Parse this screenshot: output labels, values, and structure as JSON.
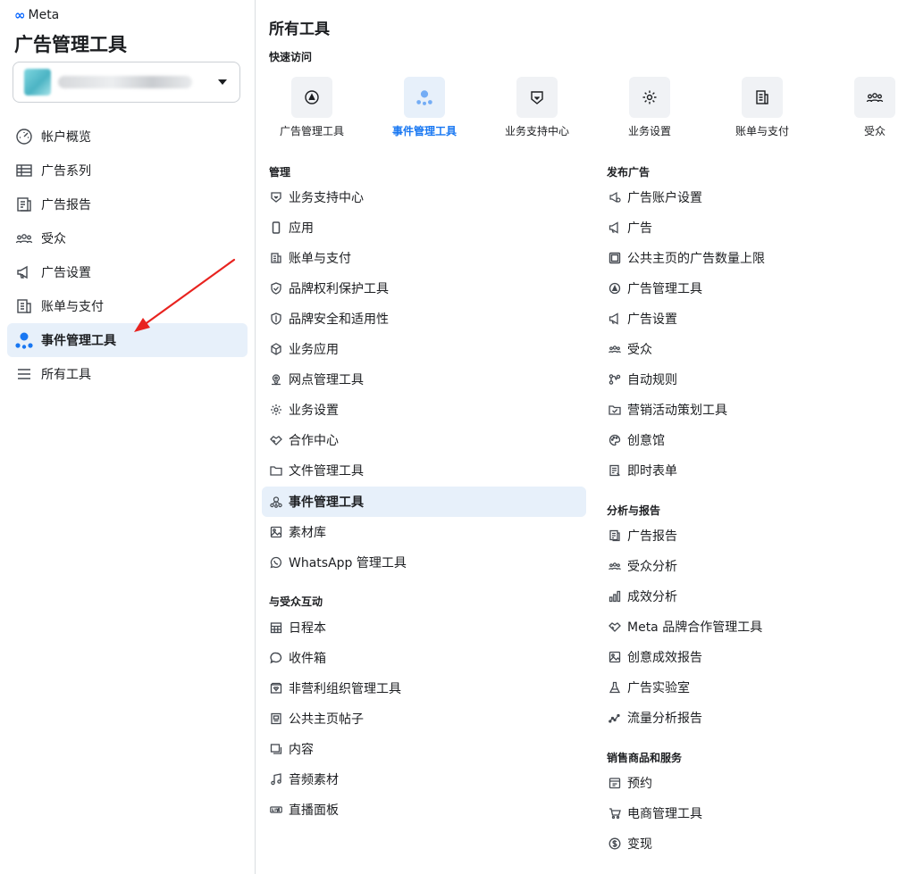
{
  "brand": {
    "logo": "∞",
    "name": "Meta"
  },
  "app_title": "广告管理工具",
  "sidebar": {
    "items": [
      {
        "label": "帐户概览",
        "icon": "gauge-icon"
      },
      {
        "label": "广告系列",
        "icon": "table-icon"
      },
      {
        "label": "广告报告",
        "icon": "report-icon"
      },
      {
        "label": "受众",
        "icon": "people-icon"
      },
      {
        "label": "广告设置",
        "icon": "megaphone-icon"
      },
      {
        "label": "账单与支付",
        "icon": "billing-icon"
      },
      {
        "label": "事件管理工具",
        "icon": "events-icon",
        "active": true
      },
      {
        "label": "所有工具",
        "icon": "menu-icon"
      }
    ]
  },
  "main": {
    "title": "所有工具",
    "quick_access": {
      "title": "快速访问",
      "items": [
        {
          "label": "广告管理工具",
          "icon": "ads-manager-icon"
        },
        {
          "label": "事件管理工具",
          "icon": "events-icon",
          "active": true
        },
        {
          "label": "业务支持中心",
          "icon": "shield-icon"
        },
        {
          "label": "业务设置",
          "icon": "gear-icon"
        },
        {
          "label": "账单与支付",
          "icon": "billing-icon"
        },
        {
          "label": "受众",
          "icon": "people-icon"
        }
      ]
    },
    "manage": {
      "title": "管理",
      "items": [
        "业务支持中心",
        "应用",
        "账单与支付",
        "品牌权利保护工具",
        "品牌安全和适用性",
        "业务应用",
        "网点管理工具",
        "业务设置",
        "合作中心",
        "文件管理工具",
        "事件管理工具",
        "素材库",
        "WhatsApp 管理工具"
      ],
      "active_index": 10
    },
    "engage": {
      "title": "与受众互动",
      "items": [
        "日程本",
        "收件箱",
        "非营利组织管理工具",
        "公共主页帖子",
        "内容",
        "音频素材",
        "直播面板"
      ]
    },
    "publish": {
      "title": "发布广告",
      "items": [
        "广告账户设置",
        "广告",
        "公共主页的广告数量上限",
        "广告管理工具",
        "广告设置",
        "受众",
        "自动规则",
        "营销活动策划工具",
        "创意馆",
        "即时表单"
      ]
    },
    "analyze": {
      "title": "分析与报告",
      "items": [
        "广告报告",
        "受众分析",
        "成效分析",
        "Meta 品牌合作管理工具",
        "创意成效报告",
        "广告实验室",
        "流量分析报告"
      ]
    },
    "sell": {
      "title": "销售商品和服务",
      "items": [
        "预约",
        "电商管理工具",
        "变现"
      ]
    }
  },
  "colors": {
    "accent": "#1877f2",
    "active_bg": "#e7f0fa",
    "annotation_arrow": "#e8231f"
  }
}
